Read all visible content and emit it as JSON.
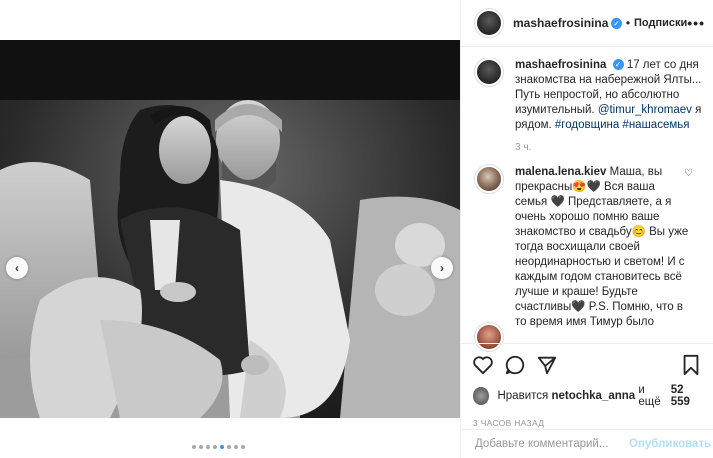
{
  "post": {
    "author": "mashaefrosinina",
    "follow_label": "Подписки",
    "separator": "•",
    "more_label": "•••"
  },
  "caption": {
    "username": "mashaefrosinina",
    "text_part1": "17 лет со дня знакомства на набережной Ялты... Путь непростой, но абсолютно изумительный.",
    "mention": "@timur_khromaev",
    "text_part2": "я рядом.",
    "hashtags": "#годовщина #нашасемья",
    "time": "3 ч."
  },
  "comments": [
    {
      "username": "malena.lena.kiev",
      "text": "Маша, вы прекрасны😍🖤 Вся ваша семья 🖤 Представляете, а я очень хорошо помню ваше знакомство и свадьбу😊 Вы уже тогда восхищали своей неординарностью и светом! И с каждым годом становитесь всё лучше и краше! Будьте счастливы🖤 P.S. Помню, что в то время имя Тимур было"
    }
  ],
  "likes": {
    "prefix": "Нравится",
    "user": "netochka_anna",
    "conjunction": "и ещё",
    "count": "52 559"
  },
  "timestamp": "3 ЧАСОВ НАЗАД",
  "comment_input": {
    "placeholder": "Добавьте комментарий...",
    "publish_label": "Опубликовать"
  },
  "carousel": {
    "prev_icon": "chevron-left-icon",
    "next_icon": "chevron-right-icon",
    "dot_count": 8,
    "active_dot": 4
  },
  "colors": {
    "link": "#003569",
    "accent": "#3897f0",
    "publish_disabled": "#b2dffc"
  }
}
